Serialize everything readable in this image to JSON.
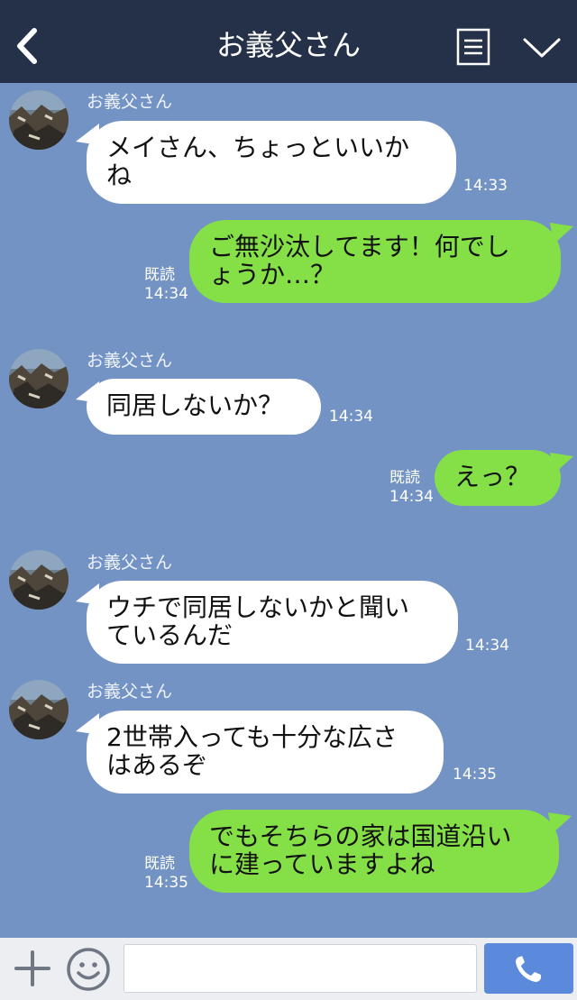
{
  "header": {
    "title": "お義父さん",
    "back_icon": "chevron-left-icon",
    "menu_icon": "notes-icon",
    "expand_icon": "chevron-down-icon"
  },
  "messages": [
    {
      "direction": "in",
      "sender": "お義父さん",
      "line1": "メイさん、ちょっといいか",
      "line2": "ね",
      "time": "14:33"
    },
    {
      "direction": "out",
      "read": "既読",
      "line1": "ご無沙汰してます！何でし",
      "line2": "ょうか…？",
      "time": "14:34"
    },
    {
      "direction": "in",
      "sender": "お義父さん",
      "line1": "同居しないか？",
      "time": "14:34"
    },
    {
      "direction": "out",
      "read": "既読",
      "line1": "えっ？",
      "time": "14:34"
    },
    {
      "direction": "in",
      "sender": "お義父さん",
      "line1": "ウチで同居しないかと聞い",
      "line2": "ているんだ",
      "time": "14:34"
    },
    {
      "direction": "in",
      "sender": "お義父さん",
      "line1": "2世帯入っても十分な広さ",
      "line2": "はあるぞ",
      "time": "14:35"
    },
    {
      "direction": "out",
      "read": "既読",
      "line1": "でもそちらの家は国道沿い",
      "line2": "に建っていますよね",
      "time": "14:35"
    }
  ],
  "footer": {
    "input_value": "",
    "plus_icon": "plus-icon",
    "emoji_icon": "smile-icon",
    "call_icon": "phone-icon"
  },
  "colors": {
    "header_bg": "#253149",
    "chat_bg": "#7393c4",
    "incoming_bubble": "#ffffff",
    "outgoing_bubble": "#85e048",
    "call_button": "#5b89dc"
  }
}
